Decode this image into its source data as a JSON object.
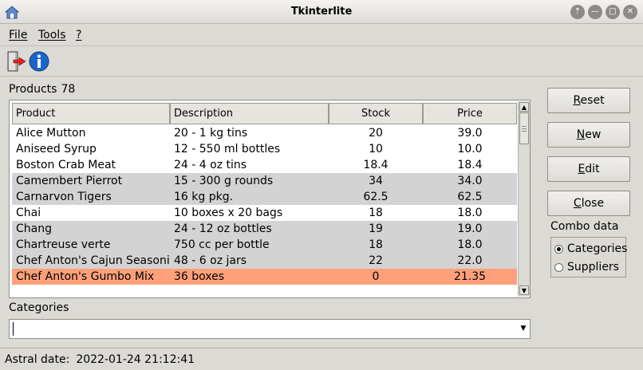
{
  "window": {
    "title": "Tkinterlite"
  },
  "menu": {
    "file": "File",
    "tools": "Tools",
    "help": "?"
  },
  "toolbar": {
    "exit_icon": "exit-door-icon",
    "info_icon": "info-icon"
  },
  "products": {
    "label": "Products",
    "count": "78",
    "columns": [
      "Product",
      "Description",
      "Stock",
      "Price"
    ],
    "rows": [
      {
        "product": "Alice Mutton",
        "description": "20 - 1 kg tins",
        "stock": "20",
        "price": "39.0",
        "style": "normal"
      },
      {
        "product": "Aniseed Syrup",
        "description": "12 - 550 ml bottles",
        "stock": "10",
        "price": "10.0",
        "style": "normal"
      },
      {
        "product": "Boston Crab Meat",
        "description": "24 - 4 oz tins",
        "stock": "18.4",
        "price": "18.4",
        "style": "normal"
      },
      {
        "product": "Camembert Pierrot",
        "description": "15 - 300 g rounds",
        "stock": "34",
        "price": "34.0",
        "style": "grey"
      },
      {
        "product": "Carnarvon Tigers",
        "description": "16 kg pkg.",
        "stock": "62.5",
        "price": "62.5",
        "style": "grey"
      },
      {
        "product": "Chai",
        "description": "10 boxes x 20 bags",
        "stock": "18",
        "price": "18.0",
        "style": "normal"
      },
      {
        "product": "Chang",
        "description": "24 - 12 oz bottles",
        "stock": "19",
        "price": "19.0",
        "style": "grey"
      },
      {
        "product": "Chartreuse verte",
        "description": "750 cc per bottle",
        "stock": "18",
        "price": "18.0",
        "style": "grey"
      },
      {
        "product": "Chef Anton's Cajun Seasoning",
        "description": "48 - 6 oz jars",
        "stock": "22",
        "price": "22.0",
        "style": "grey"
      },
      {
        "product": "Chef Anton's Gumbo Mix",
        "description": "36 boxes",
        "stock": "0",
        "price": "21.35",
        "style": "salmon"
      }
    ]
  },
  "categories": {
    "label": "Categories",
    "value": ""
  },
  "buttons": {
    "reset": {
      "u": "R",
      "rest": "eset"
    },
    "new": {
      "u": "N",
      "rest": "ew"
    },
    "edit": {
      "u": "E",
      "rest": "dit"
    },
    "close": {
      "u": "C",
      "rest": "lose"
    }
  },
  "combo_data": {
    "label": "Combo data",
    "options": [
      "Categories",
      "Suppliers"
    ],
    "selected": "Categories"
  },
  "status": {
    "label": "Astral date:",
    "value": "2022-01-24 21:12:41"
  },
  "colors": {
    "grey_row": "#d3d3d3",
    "salmon_row": "#ffa07a",
    "background": "#dcdad5"
  }
}
